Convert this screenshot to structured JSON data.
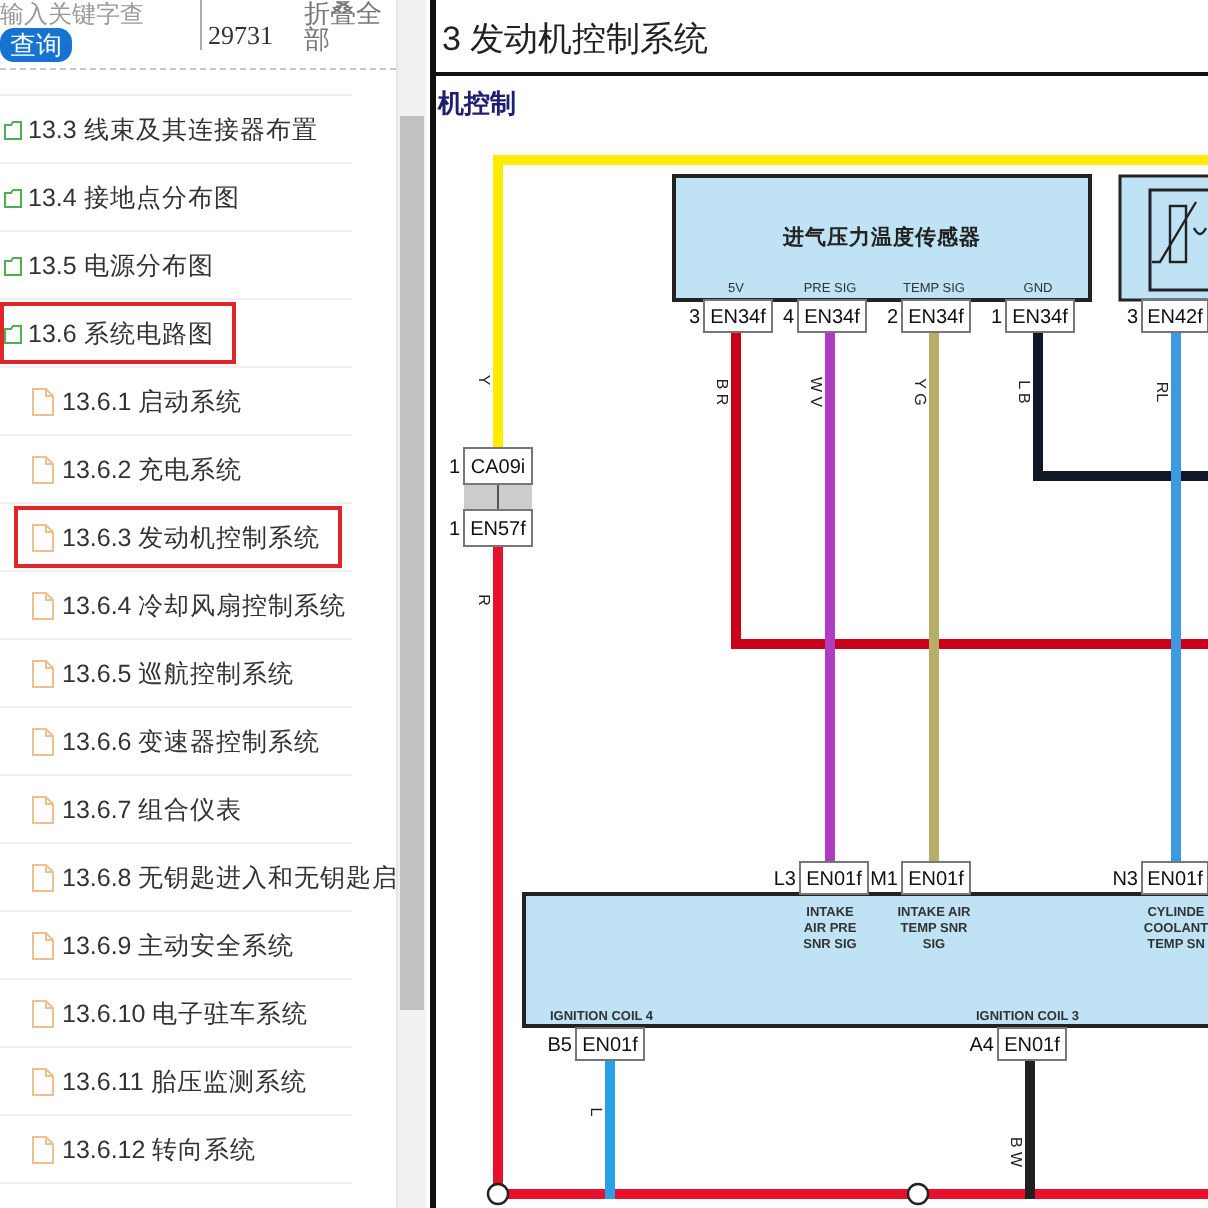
{
  "sidebar": {
    "search": {
      "placeholder": "输入关键字查"
    },
    "search_button": "查询",
    "number": "29731",
    "collapse_button": "折叠全部",
    "tree": [
      {
        "kind": "folder",
        "label": "13.3 线束及其连接器布置",
        "highlighted": false
      },
      {
        "kind": "folder",
        "label": "13.4 接地点分布图",
        "highlighted": false
      },
      {
        "kind": "folder",
        "label": "13.5 电源分布图",
        "highlighted": false
      },
      {
        "kind": "folder",
        "label": "13.6 系统电路图",
        "highlighted": true,
        "children": [
          {
            "kind": "page",
            "label": "13.6.1 启动系统",
            "highlighted": false
          },
          {
            "kind": "page",
            "label": "13.6.2 充电系统",
            "highlighted": false
          },
          {
            "kind": "page",
            "label": "13.6.3 发动机控制系统",
            "highlighted": true
          },
          {
            "kind": "page",
            "label": "13.6.4 冷却风扇控制系统",
            "highlighted": false
          },
          {
            "kind": "page",
            "label": "13.6.5 巡航控制系统",
            "highlighted": false
          },
          {
            "kind": "page",
            "label": "13.6.6 变速器控制系统",
            "highlighted": false
          },
          {
            "kind": "page",
            "label": "13.6.7 组合仪表",
            "highlighted": false
          },
          {
            "kind": "page",
            "label": "13.6.8 无钥匙进入和无钥匙启",
            "highlighted": false
          },
          {
            "kind": "page",
            "label": "13.6.9 主动安全系统",
            "highlighted": false
          },
          {
            "kind": "page",
            "label": "13.6.10 电子驻车系统",
            "highlighted": false
          },
          {
            "kind": "page",
            "label": "13.6.11 胎压监测系统",
            "highlighted": false
          },
          {
            "kind": "page",
            "label": "13.6.12 转向系统",
            "highlighted": false
          }
        ]
      }
    ]
  },
  "document": {
    "title": "3 发动机控制系统",
    "subtitle": "机控制",
    "diagram": {
      "components": [
        {
          "kind": "sensor",
          "label": "进气压力温度传感器",
          "pins": [
            "5V",
            "PRE SIG",
            "TEMP SIG",
            "GND"
          ]
        },
        {
          "kind": "thermistor"
        },
        {
          "kind": "ecu",
          "signals": [
            [
              "INTAKE",
              "AIR PRE",
              "SNR SIG"
            ],
            [
              "INTAKE AIR",
              "TEMP SNR",
              "SIG"
            ],
            [
              "CYLINDE",
              "COOLANT",
              "TEMP SN"
            ]
          ],
          "outputs": [
            "IGNITION COIL 4",
            "IGNITION COIL 3"
          ]
        }
      ],
      "connectors": [
        {
          "pin": "1",
          "code": "CA09i"
        },
        {
          "pin": "1",
          "code": "EN57f"
        },
        {
          "pin": "3",
          "code": "EN34f"
        },
        {
          "pin": "4",
          "code": "EN34f"
        },
        {
          "pin": "2",
          "code": "EN34f"
        },
        {
          "pin": "1",
          "code": "EN34f"
        },
        {
          "pin": "3",
          "code": "EN42f"
        },
        {
          "pin": "L3",
          "code": "EN01f"
        },
        {
          "pin": "M1",
          "code": "EN01f"
        },
        {
          "pin": "N3",
          "code": "EN01f"
        },
        {
          "pin": "B5",
          "code": "EN01f"
        },
        {
          "pin": "A4",
          "code": "EN01f"
        }
      ],
      "wires": [
        {
          "code": "Y",
          "color": "#ffec00"
        },
        {
          "code": "R",
          "color": "#e8102a"
        },
        {
          "code": "B R",
          "color": "#c8001c"
        },
        {
          "code": "W V",
          "color": "#b03cc0"
        },
        {
          "code": "Y G",
          "color": "#b5b066"
        },
        {
          "code": "L B",
          "color": "#101828"
        },
        {
          "code": "RL",
          "color": "#3d9ae0"
        },
        {
          "code": "L",
          "color": "#2aa0e8"
        },
        {
          "code": "B W",
          "color": "#202020"
        }
      ]
    }
  }
}
